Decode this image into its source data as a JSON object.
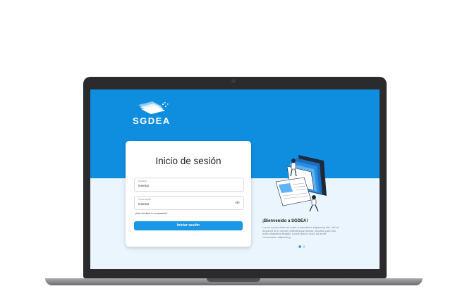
{
  "app": {
    "name": "SGDEA"
  },
  "login": {
    "title": "Inicio de sesión",
    "username_label": "Usuario",
    "username_value": "Insertar",
    "password_label": "Contraseña",
    "password_value": "Insertar",
    "forgot_link": "¿Has olvidado tu contraseña?",
    "submit_label": "Iniciar sesión"
  },
  "welcome": {
    "title": "¡Bienvenido a SGDEA!",
    "text": "Lorem ipsum dolor sit amet consectetur adipiscing elit, nisl at tincidunt et in rutrum pellentesque auctor, lobortis justo nec nulla phasellus feugiat. Lorem ipsum dolor sit amet consectetur adipiscing."
  },
  "carousel": {
    "slide_count": 2,
    "active_index": 0
  },
  "icons": [
    "document-stack-icon",
    "eye-icon",
    "document-folder-illustration"
  ],
  "colors": {
    "primary": "#0f8ee0",
    "button": "#1a97e6",
    "background_light": "#eaf5fd"
  }
}
